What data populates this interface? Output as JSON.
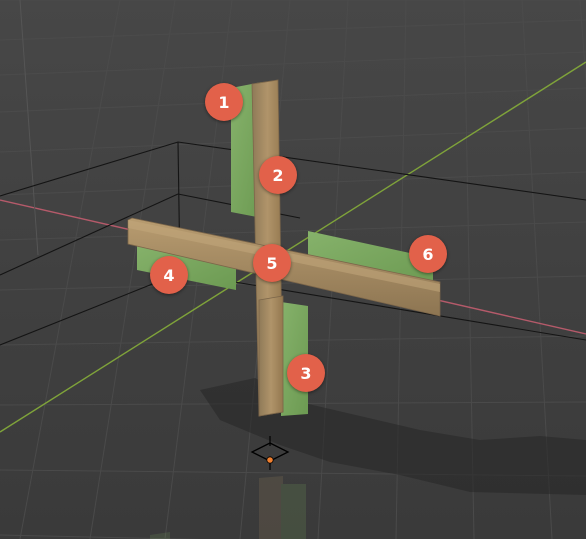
{
  "viewport": {
    "markers": [
      {
        "label": "1"
      },
      {
        "label": "2"
      },
      {
        "label": "3"
      },
      {
        "label": "4"
      },
      {
        "label": "5"
      },
      {
        "label": "6"
      }
    ]
  },
  "colors": {
    "background": "#3e3e3e",
    "grid_line": "#4a4a4a",
    "x_axis": "#b55a6a",
    "y_axis": "#7fa33a",
    "wood_bar": "#a58a62",
    "green_plane": "#7aa860",
    "marker": "#e2614a",
    "object_origin": "#f08030"
  }
}
